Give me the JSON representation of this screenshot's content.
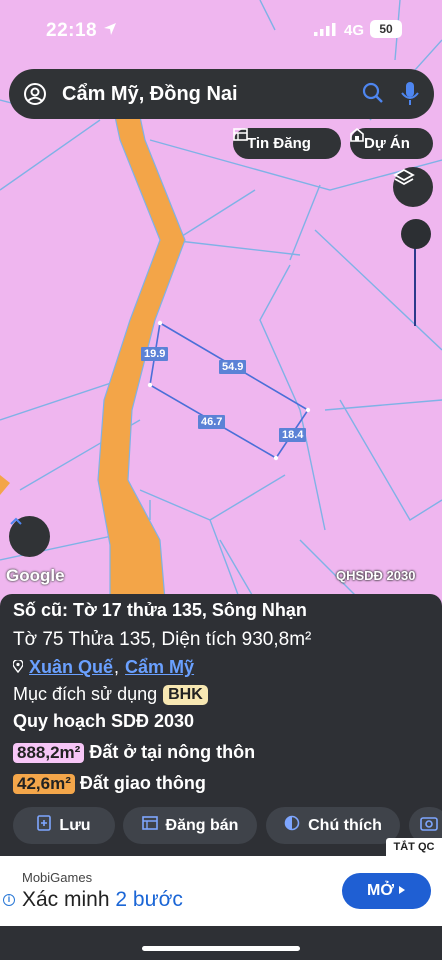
{
  "status_bar": {
    "time": "22:18",
    "network": "4G",
    "battery": "50"
  },
  "search": {
    "query": "Cẩm Mỹ, Đồng Nai"
  },
  "chips": {
    "listings": "Tin Đăng",
    "projects": "Dự Án"
  },
  "map": {
    "google_label": "Google",
    "plan_label": "QHSDĐ 2030",
    "measurements": [
      "19.9",
      "54.9",
      "46.7",
      "18.4"
    ]
  },
  "panel": {
    "old_parcel": "Số cũ: Tờ 17 thửa 135, Sông Nhạn",
    "parcel": "Tờ 75 Thửa 135, Diện tích 930,8m²",
    "ward": "Xuân Quế",
    "separator": ",",
    "district": "Cẩm Mỹ",
    "purpose_label": "Mục đích sử dụng",
    "purpose_code": "BHK",
    "plan_title": "Quy hoạch SDĐ 2030",
    "zones": [
      {
        "area": "888,2m²",
        "name": "Đất ở tại nông thôn",
        "color": "#f7c6f7"
      },
      {
        "area": "42,6m²",
        "name": "Đất giao thông",
        "color": "#f4a64a"
      }
    ],
    "actions": {
      "save": "Lưu",
      "post": "Đăng bán",
      "legend": "Chú thích"
    }
  },
  "ad": {
    "close_label": "TẮT QC",
    "brand": "MobiGames",
    "headline_prefix": "Xác minh ",
    "headline_highlight": "2 bước",
    "cta": "MỞ"
  },
  "colors": {
    "map_bg": "#efb6ef",
    "road": "#f3a548",
    "panel": "#2e3035",
    "accent": "#1f5fd3"
  }
}
